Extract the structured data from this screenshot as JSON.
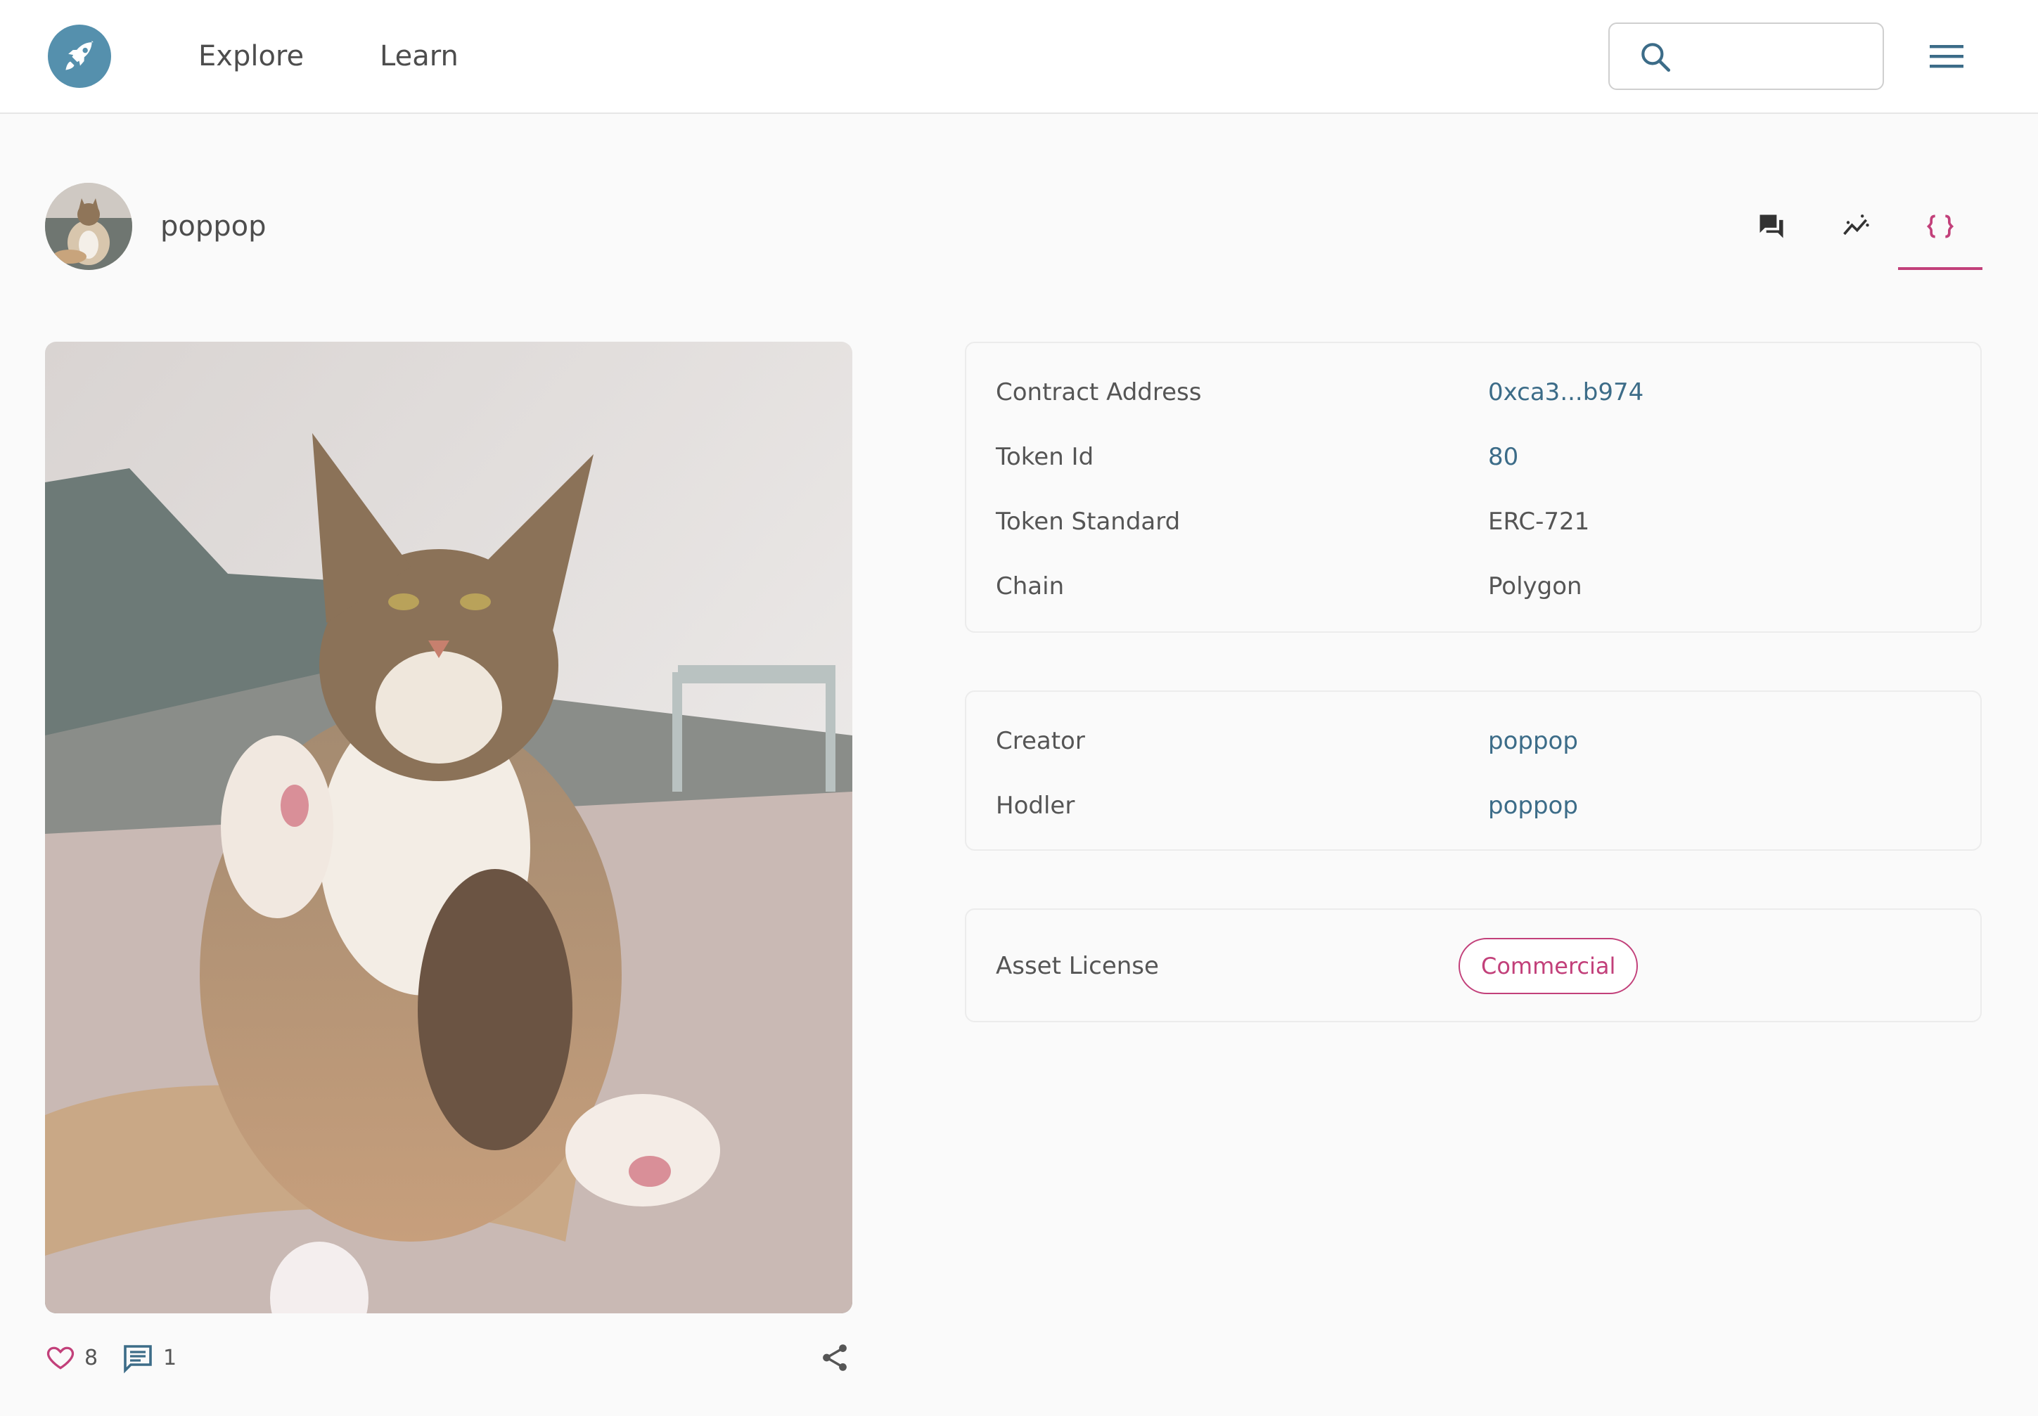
{
  "nav": {
    "logo_icon": "rocket-icon",
    "explore_label": "Explore",
    "learn_label": "Learn",
    "search_placeholder": "",
    "search_value": "",
    "menu_icon": "hamburger-menu-icon"
  },
  "owner": {
    "name": "poppop",
    "avatar_alt": "cat avatar"
  },
  "tabs": [
    {
      "icon": "comments-icon",
      "active": false
    },
    {
      "icon": "activity-chart-icon",
      "active": false
    },
    {
      "icon": "code-braces-icon",
      "active": true
    }
  ],
  "artwork": {
    "likes": "8",
    "comments": "1"
  },
  "contract": {
    "rows": [
      {
        "label": "Contract Address",
        "value": "0xca3...b974"
      },
      {
        "label": "Token Id",
        "value": "80"
      },
      {
        "label": "Token Standard",
        "value": "ERC-721"
      },
      {
        "label": "Chain",
        "value": "Polygon"
      }
    ]
  },
  "people": {
    "rows": [
      {
        "label": "Creator",
        "value": "poppop"
      },
      {
        "label": "Hodler",
        "value": "poppop"
      }
    ]
  },
  "license": {
    "label": "Asset License",
    "value": "Commercial"
  },
  "colors": {
    "accent": "#c2407a",
    "link": "#3c6c88",
    "logo": "#5590ad",
    "background": "#fafafa"
  }
}
